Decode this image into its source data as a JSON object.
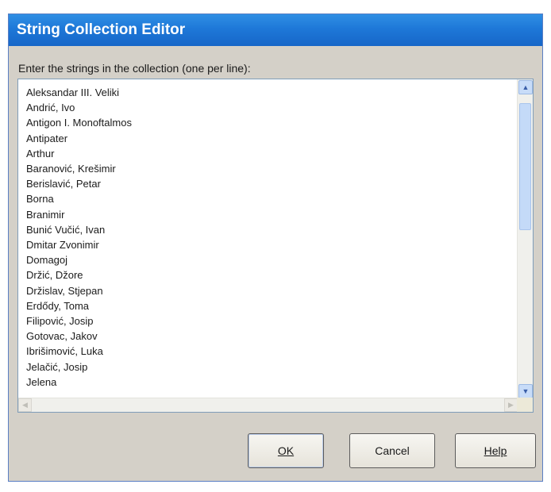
{
  "window": {
    "title": "String Collection Editor"
  },
  "prompt": "Enter the strings in the collection (one per line):",
  "strings": [
    "Aleksandar III. Veliki",
    "Andrić, Ivo",
    "Antigon I. Monoftalmos",
    "Antipater",
    "Arthur",
    "Baranović, Krešimir",
    "Berislavić, Petar",
    "Borna",
    "Branimir",
    "Bunić Vučić, Ivan",
    "Dmitar Zvonimir",
    "Domagoj",
    "Držić, Džore",
    "Držislav, Stjepan",
    "Erdődy, Toma",
    "Filipović, Josip",
    "Gotovac, Jakov",
    "Ibrišimović, Luka",
    "Jelačić, Josip",
    "Jelena"
  ],
  "buttons": {
    "ok": "OK",
    "cancel": "Cancel",
    "help": "Help"
  },
  "icons": {
    "scroll_up": "scroll-up-arrow-icon",
    "scroll_down": "scroll-down-arrow-icon",
    "scroll_left": "scroll-left-arrow-icon",
    "scroll_right": "scroll-right-arrow-icon"
  },
  "colors": {
    "titlebar": "#1e78d8",
    "dialog_bg": "#d4d0c8",
    "scroll_accent": "#c4daf8"
  }
}
